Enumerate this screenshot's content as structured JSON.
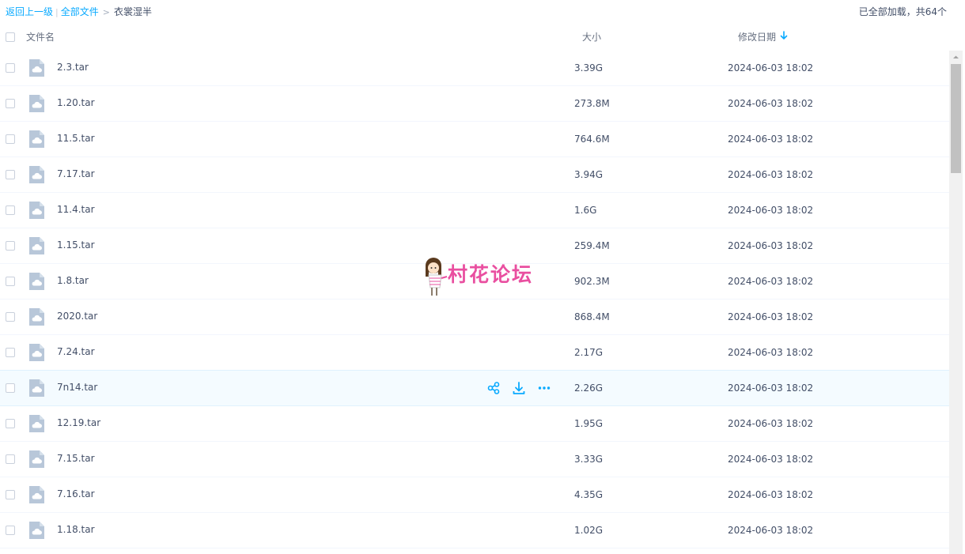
{
  "breadcrumb": {
    "back": "返回上一级",
    "divider": "|",
    "root": "全部文件",
    "arrow": ">",
    "current": "衣裳湿半"
  },
  "status": {
    "loaded": "已全部加载，共64个"
  },
  "columns": {
    "name": "文件名",
    "size": "大小",
    "modified": "修改日期"
  },
  "files": [
    {
      "name": "2.3.tar",
      "size": "3.39G",
      "date": "2024-06-03 18:02"
    },
    {
      "name": "1.20.tar",
      "size": "273.8M",
      "date": "2024-06-03 18:02"
    },
    {
      "name": "11.5.tar",
      "size": "764.6M",
      "date": "2024-06-03 18:02"
    },
    {
      "name": "7.17.tar",
      "size": "3.94G",
      "date": "2024-06-03 18:02"
    },
    {
      "name": "11.4.tar",
      "size": "1.6G",
      "date": "2024-06-03 18:02"
    },
    {
      "name": "1.15.tar",
      "size": "259.4M",
      "date": "2024-06-03 18:02"
    },
    {
      "name": "1.8.tar",
      "size": "902.3M",
      "date": "2024-06-03 18:02"
    },
    {
      "name": "2020.tar",
      "size": "868.4M",
      "date": "2024-06-03 18:02"
    },
    {
      "name": "7.24.tar",
      "size": "2.17G",
      "date": "2024-06-03 18:02"
    },
    {
      "name": "7n14.tar",
      "size": "2.26G",
      "date": "2024-06-03 18:02",
      "hovered": true
    },
    {
      "name": "12.19.tar",
      "size": "1.95G",
      "date": "2024-06-03 18:02"
    },
    {
      "name": "7.15.tar",
      "size": "3.33G",
      "date": "2024-06-03 18:02"
    },
    {
      "name": "7.16.tar",
      "size": "4.35G",
      "date": "2024-06-03 18:02"
    },
    {
      "name": "1.18.tar",
      "size": "1.02G",
      "date": "2024-06-03 18:02"
    }
  ],
  "row_actions": [
    "share-icon",
    "download-icon",
    "more-icon"
  ],
  "watermark": {
    "text": "村花论坛"
  },
  "colors": {
    "link": "#09aaff",
    "text": "#424e67",
    "hover_row": "#f4fbff",
    "file_icon": "#b8c7d9",
    "watermark": "#e94fa0"
  }
}
